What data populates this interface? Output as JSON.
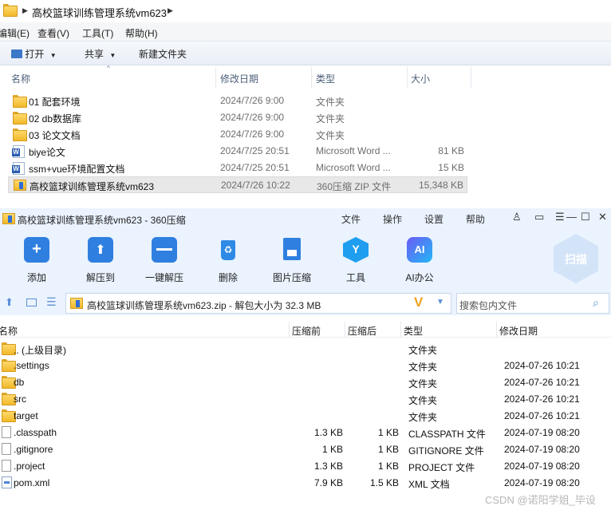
{
  "explorer": {
    "breadcrumb": "高校篮球训练管理系统vm623",
    "menu": [
      "编辑(E)",
      "查看(V)",
      "工具(T)",
      "帮助(H)"
    ],
    "toolbar": {
      "open": "打开",
      "share": "共享",
      "new_folder": "新建文件夹"
    },
    "columns": {
      "name": "名称",
      "date": "修改日期",
      "type": "类型",
      "size": "大小"
    },
    "rows": [
      {
        "icon": "folder-icon",
        "name": "01 配套环境",
        "date": "2024/7/26 9:00",
        "type": "文件夹",
        "size": ""
      },
      {
        "icon": "folder-icon",
        "name": "02 db数据库",
        "date": "2024/7/26 9:00",
        "type": "文件夹",
        "size": ""
      },
      {
        "icon": "folder-icon",
        "name": "03 论文文档",
        "date": "2024/7/26 9:00",
        "type": "文件夹",
        "size": ""
      },
      {
        "icon": "word-doc-icon",
        "name": "biye论文",
        "date": "2024/7/25 20:51",
        "type": "Microsoft Word ...",
        "size": "81 KB"
      },
      {
        "icon": "word-doc-icon",
        "name": "ssm+vue环境配置文档",
        "date": "2024/7/25 20:51",
        "type": "Microsoft Word ...",
        "size": "15 KB"
      },
      {
        "icon": "zip-icon",
        "name": "高校篮球训练管理系统vm623",
        "date": "2024/7/26 10:22",
        "type": "360压缩 ZIP 文件",
        "size": "15,348 KB"
      }
    ]
  },
  "zip": {
    "title": "高校篮球训练管理系统vm623 - 360压缩",
    "menu": [
      "文件",
      "操作",
      "设置",
      "帮助"
    ],
    "tools": [
      {
        "label": "添加",
        "icon": "add-icon"
      },
      {
        "label": "解压到",
        "icon": "extract-to-icon"
      },
      {
        "label": "一键解压",
        "icon": "one-click-extract-icon"
      },
      {
        "label": "删除",
        "icon": "delete-icon"
      },
      {
        "label": "图片压缩",
        "icon": "image-compress-icon"
      },
      {
        "label": "工具",
        "icon": "tools-icon"
      },
      {
        "label": "AI办公",
        "icon": "ai-office-icon"
      }
    ],
    "scan_label": "扫描",
    "ai_badge": "AI",
    "address": "高校篮球训练管理系统vm623.zip - 解包大小为 32.3 MB",
    "search_placeholder": "搜索包内文件",
    "columns": {
      "name": "名称",
      "before": "压缩前",
      "after": "压缩后",
      "type": "类型",
      "mtime": "修改日期"
    },
    "rows": [
      {
        "icon": "folder-icon",
        "name": ".. (上级目录)",
        "before": "",
        "after": "",
        "type": "文件夹",
        "mtime": ""
      },
      {
        "icon": "folder-icon",
        "name": ".settings",
        "before": "",
        "after": "",
        "type": "文件夹",
        "mtime": "2024-07-26 10:21"
      },
      {
        "icon": "folder-icon",
        "name": "db",
        "before": "",
        "after": "",
        "type": "文件夹",
        "mtime": "2024-07-26 10:21"
      },
      {
        "icon": "folder-icon",
        "name": "src",
        "before": "",
        "after": "",
        "type": "文件夹",
        "mtime": "2024-07-26 10:21"
      },
      {
        "icon": "folder-icon",
        "name": "target",
        "before": "",
        "after": "",
        "type": "文件夹",
        "mtime": "2024-07-26 10:21"
      },
      {
        "icon": "file-icon",
        "name": ".classpath",
        "before": "1.3 KB",
        "after": "1 KB",
        "type": "CLASSPATH 文件",
        "mtime": "2024-07-19 08:20"
      },
      {
        "icon": "file-icon",
        "name": ".gitignore",
        "before": "1 KB",
        "after": "1 KB",
        "type": "GITIGNORE 文件",
        "mtime": "2024-07-19 08:20"
      },
      {
        "icon": "file-icon",
        "name": ".project",
        "before": "1.3 KB",
        "after": "1 KB",
        "type": "PROJECT 文件",
        "mtime": "2024-07-19 08:20"
      },
      {
        "icon": "xml-file-icon",
        "name": "pom.xml",
        "before": "7.9 KB",
        "after": "1.5 KB",
        "type": "XML 文档",
        "mtime": "2024-07-19 08:20"
      }
    ]
  },
  "watermark": "CSDN @诺阳学姐_毕设"
}
